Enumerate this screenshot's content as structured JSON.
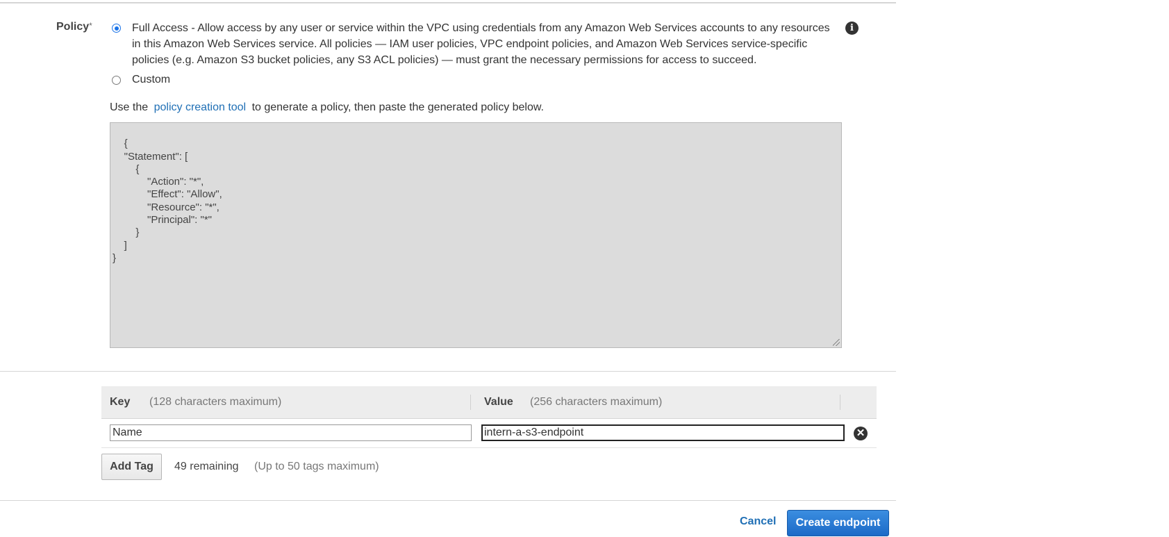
{
  "policy": {
    "label": "Policy",
    "required_mark": "*",
    "options": [
      {
        "id": "full-access",
        "label": "Full Access - Allow access by any user or service within the VPC using credentials from any Amazon Web Services accounts to any resources in this Amazon Web Services service. All policies — IAM user policies, VPC endpoint policies, and Amazon Web Services service-specific policies (e.g. Amazon S3 bucket policies, any S3 ACL policies) — must grant the necessary permissions for access to succeed.",
        "selected": true
      },
      {
        "id": "custom",
        "label": "Custom",
        "selected": false
      }
    ],
    "tool_prefix": "Use the",
    "tool_link": "policy creation tool",
    "tool_suffix": "to generate a policy, then paste the generated policy below.",
    "document": "{\n    \"Statement\": [\n        {\n            \"Action\": \"*\",\n            \"Effect\": \"Allow\",\n            \"Resource\": \"*\",\n            \"Principal\": \"*\"\n        }\n    ]\n}"
  },
  "tags": {
    "key_header": "Key",
    "key_hint": "(128 characters maximum)",
    "value_header": "Value",
    "value_hint": "(256 characters maximum)",
    "rows": [
      {
        "key": "Name",
        "value": "intern-a-s3-endpoint"
      }
    ],
    "add_label": "Add Tag",
    "remaining": "49 remaining",
    "max_hint": "(Up to 50 tags maximum)"
  },
  "footer": {
    "cancel_label": "Cancel",
    "create_label": "Create endpoint"
  },
  "colors": {
    "accent": "#1f6fb5",
    "primary_button": "#1b6ac7",
    "readonly_bg": "#dcdcdc"
  },
  "icons": {
    "info": "info-icon",
    "remove": "remove-tag-icon"
  }
}
